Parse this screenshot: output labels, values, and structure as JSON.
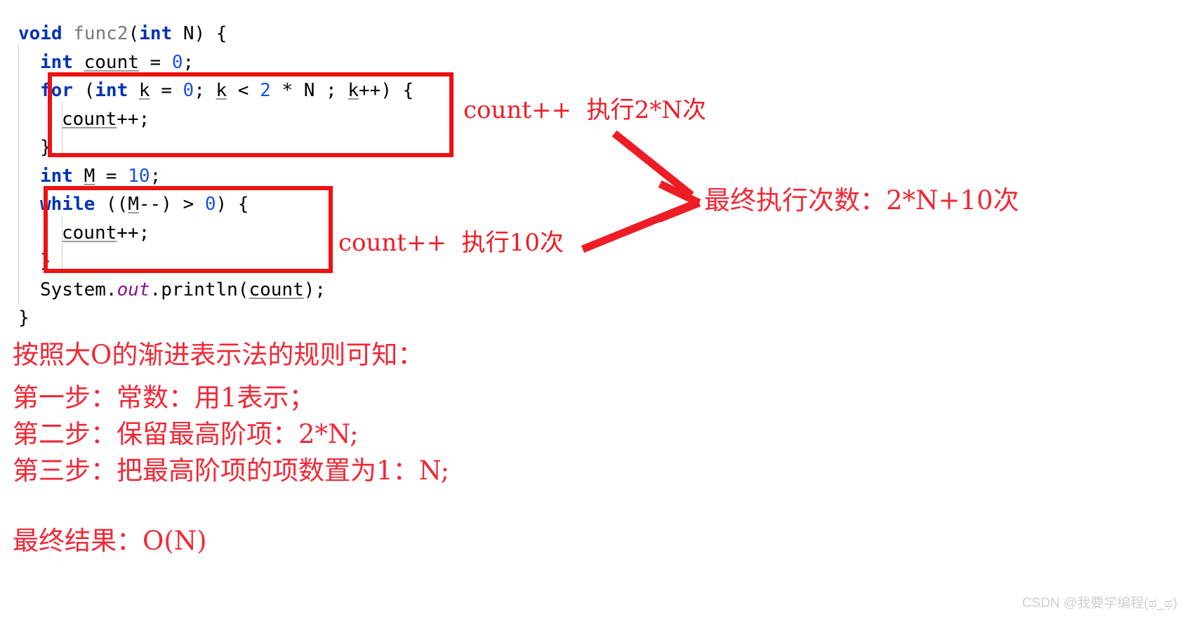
{
  "code": {
    "language": "java",
    "lines": [
      {
        "indent": 0,
        "tokens": [
          {
            "t": "void ",
            "c": "kw"
          },
          {
            "t": "func2",
            "c": "fn"
          },
          {
            "t": "(",
            "c": "plain"
          },
          {
            "t": "int",
            "c": "kw"
          },
          {
            "t": " N) {",
            "c": "plain"
          }
        ]
      },
      {
        "indent": 1,
        "tokens": [
          {
            "t": "int",
            "c": "kw"
          },
          {
            "t": " ",
            "c": "plain"
          },
          {
            "t": "count",
            "c": "var"
          },
          {
            "t": " = ",
            "c": "plain"
          },
          {
            "t": "0",
            "c": "num"
          },
          {
            "t": ";",
            "c": "plain"
          }
        ]
      },
      {
        "indent": 1,
        "tokens": [
          {
            "t": "for",
            "c": "kw"
          },
          {
            "t": " (",
            "c": "plain"
          },
          {
            "t": "int",
            "c": "kw"
          },
          {
            "t": " ",
            "c": "plain"
          },
          {
            "t": "k",
            "c": "var"
          },
          {
            "t": " = ",
            "c": "plain"
          },
          {
            "t": "0",
            "c": "num"
          },
          {
            "t": "; ",
            "c": "plain"
          },
          {
            "t": "k",
            "c": "var"
          },
          {
            "t": " < ",
            "c": "plain"
          },
          {
            "t": "2",
            "c": "num"
          },
          {
            "t": " * N ; ",
            "c": "plain"
          },
          {
            "t": "k",
            "c": "var"
          },
          {
            "t": "++) {",
            "c": "plain"
          }
        ]
      },
      {
        "indent": 2,
        "tokens": [
          {
            "t": "count",
            "c": "var"
          },
          {
            "t": "++;",
            "c": "plain"
          }
        ]
      },
      {
        "indent": 1,
        "tokens": [
          {
            "t": "}",
            "c": "plain"
          }
        ]
      },
      {
        "indent": 1,
        "tokens": [
          {
            "t": "int",
            "c": "kw"
          },
          {
            "t": " ",
            "c": "plain"
          },
          {
            "t": "M",
            "c": "var"
          },
          {
            "t": " = ",
            "c": "plain"
          },
          {
            "t": "10",
            "c": "num"
          },
          {
            "t": ";",
            "c": "plain"
          }
        ]
      },
      {
        "indent": 1,
        "tokens": [
          {
            "t": "while",
            "c": "kw"
          },
          {
            "t": " ((",
            "c": "plain"
          },
          {
            "t": "M",
            "c": "var"
          },
          {
            "t": "--) > ",
            "c": "plain"
          },
          {
            "t": "0",
            "c": "num"
          },
          {
            "t": ") {",
            "c": "plain"
          }
        ]
      },
      {
        "indent": 2,
        "tokens": [
          {
            "t": "count",
            "c": "var"
          },
          {
            "t": "++;",
            "c": "plain"
          }
        ]
      },
      {
        "indent": 1,
        "tokens": [
          {
            "t": "}",
            "c": "plain"
          }
        ]
      },
      {
        "indent": 1,
        "tokens": [
          {
            "t": "System.",
            "c": "plain"
          },
          {
            "t": "out",
            "c": "field"
          },
          {
            "t": ".println(",
            "c": "plain"
          },
          {
            "t": "count",
            "c": "var"
          },
          {
            "t": ");",
            "c": "plain"
          }
        ]
      },
      {
        "indent": 0,
        "tokens": [
          {
            "t": "}",
            "c": "plain"
          }
        ]
      }
    ]
  },
  "annotations": {
    "accent_color": "#ee1c25",
    "for_loop_note": "count++  执行2*N次",
    "while_loop_note": "count++  执行10次",
    "total_note": "最终执行次数：2*N+10次"
  },
  "conclusion": {
    "heading": "按照大O的渐进表示法的规则可知：",
    "steps": [
      "第一步：常数：用1表示；",
      "第二步：保留最高阶项：2*N;",
      "第三步：把最高阶项的项数置为1：N;"
    ],
    "final_result": "最终结果：O(N)"
  },
  "watermark": {
    "text": "CSDN @我要学编程(ಥ_ಥ)"
  }
}
